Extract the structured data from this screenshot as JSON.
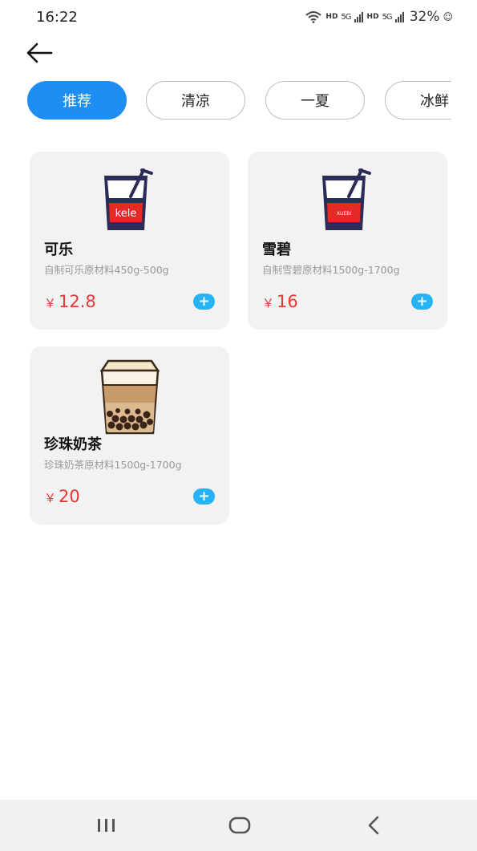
{
  "status_bar": {
    "time": "16:22",
    "hd1": "HD",
    "sig1": "5G",
    "hd2": "HD",
    "sig2": "5G",
    "battery": "32%",
    "icons": [
      "wifi-icon",
      "signal-icon",
      "battery-icon",
      "person-icon"
    ]
  },
  "header": {
    "back_icon": "arrow-left-icon"
  },
  "tabs": [
    {
      "label": "推荐",
      "active": true
    },
    {
      "label": "清凉",
      "active": false
    },
    {
      "label": "一夏",
      "active": false
    },
    {
      "label": "冰鲜",
      "active": false
    }
  ],
  "products": [
    {
      "name": "可乐",
      "desc": "自制可乐原材料450g-500g",
      "currency": "￥",
      "price": "12.8",
      "cup_label": "kele",
      "image_icon": "kele-cup-icon"
    },
    {
      "name": "雪碧",
      "desc": "自制雪碧原材料1500g-1700g",
      "currency": "￥",
      "price": "16",
      "cup_label": "XUEBI",
      "image_icon": "xuebi-cup-icon"
    },
    {
      "name": "珍珠奶茶",
      "desc": "珍珠奶茶原材料1500g-1700g",
      "currency": "￥",
      "price": "20",
      "image_icon": "milk-tea-cup-icon"
    }
  ],
  "add_label": "+",
  "colors": {
    "accent": "#1f8ef2",
    "price": "#e53935",
    "add_button": "#27b2f5",
    "card_bg": "#f2f2f3"
  },
  "nav_bar": {
    "icons": [
      "recent-apps-icon",
      "home-icon",
      "back-icon"
    ]
  }
}
